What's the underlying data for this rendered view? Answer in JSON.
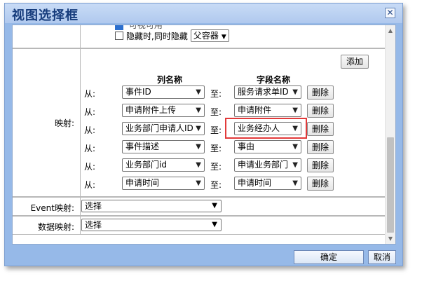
{
  "dialog": {
    "title": "视图选择框",
    "close_glyph": "✕"
  },
  "top": {
    "partial_label": "可视可用",
    "hide_label": "隐藏时,同时隐藏",
    "hide_select_value": "父容器"
  },
  "mapping": {
    "label": "映射:",
    "add_label": "添加",
    "col_header": "列名称",
    "field_header": "字段名称",
    "from_label": "从:",
    "to_label": "至:",
    "delete_label": "删除",
    "rows": [
      {
        "column": "事件ID",
        "field": "服务请求单ID"
      },
      {
        "column": "申请附件上传",
        "field": "申请附件"
      },
      {
        "column": "业务部门申请人ID",
        "field": "业务经办人"
      },
      {
        "column": "事件描述",
        "field": "事由"
      },
      {
        "column": "业务部门id",
        "field": "申请业务部门"
      },
      {
        "column": "申请时间",
        "field": "申请时间"
      }
    ]
  },
  "event_mapping": {
    "label": "Event映射:",
    "value": "选择"
  },
  "data_mapping": {
    "label": "数据映射:",
    "value": "选择"
  },
  "footer": {
    "ok_label": "确定",
    "cancel_label": "取消"
  },
  "colors": {
    "title": "#163c7c",
    "dialog_bg": "#96b9e8",
    "highlight": "#e23a3a"
  }
}
